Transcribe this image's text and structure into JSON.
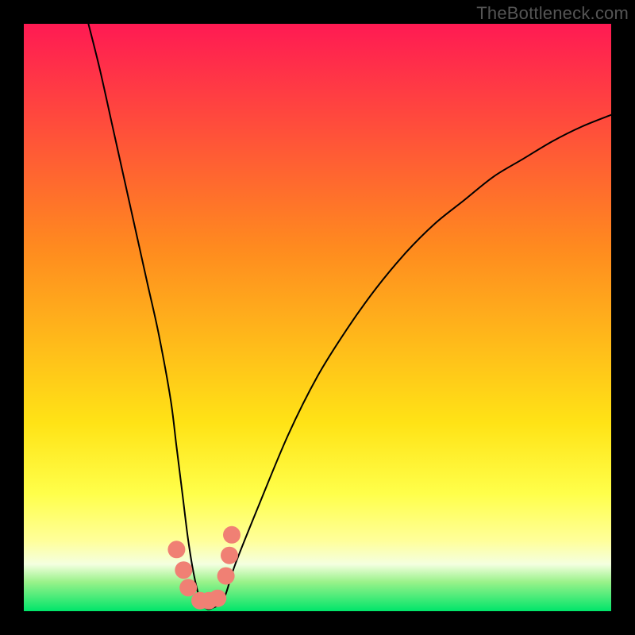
{
  "watermark": "TheBottleneck.com",
  "chart_data": {
    "type": "line",
    "title": "",
    "xlabel": "",
    "ylabel": "",
    "xlim": [
      0,
      100
    ],
    "ylim": [
      0,
      100
    ],
    "grid": false,
    "legend": false,
    "annotations": [],
    "gradient_colors": {
      "top": "#ff1a53",
      "mid_upper": "#ff8a1f",
      "mid": "#ffe316",
      "low_band": "#ffff9a",
      "bottom": "#00e56a"
    },
    "series": [
      {
        "name": "bottleneck-curve",
        "x": [
          11,
          13,
          15,
          17,
          19,
          21,
          23,
          25,
          26,
          27,
          28,
          29,
          30,
          31,
          32,
          34,
          36,
          40,
          45,
          50,
          55,
          60,
          65,
          70,
          75,
          80,
          85,
          90,
          95,
          100
        ],
        "y": [
          100,
          92,
          83,
          74,
          65,
          56,
          47,
          36,
          28,
          20,
          12,
          6,
          2,
          0.5,
          0.5,
          2,
          8,
          18,
          30,
          40,
          48,
          55,
          61,
          66,
          70,
          74,
          77,
          80,
          82.5,
          84.5
        ]
      }
    ],
    "markers": [
      {
        "x": 26.0,
        "y": 10.5
      },
      {
        "x": 27.2,
        "y": 7.0
      },
      {
        "x": 28.0,
        "y": 4.0
      },
      {
        "x": 30.0,
        "y": 1.8
      },
      {
        "x": 31.5,
        "y": 1.8
      },
      {
        "x": 33.0,
        "y": 2.2
      },
      {
        "x": 34.4,
        "y": 6.0
      },
      {
        "x": 35.0,
        "y": 9.5
      },
      {
        "x": 35.4,
        "y": 13.0
      }
    ],
    "marker_color": "#f08074",
    "marker_radius_px": 11
  }
}
